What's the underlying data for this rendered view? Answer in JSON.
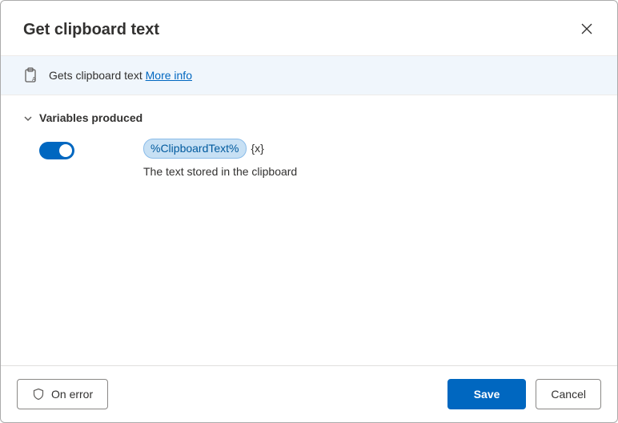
{
  "dialog": {
    "title": "Get clipboard text"
  },
  "banner": {
    "desc_prefix": "Gets clipboard text ",
    "more_info": "More info"
  },
  "section": {
    "heading": "Variables produced"
  },
  "variable": {
    "name": "%ClipboardText%",
    "type_suffix": "{x}",
    "description": "The text stored in the clipboard",
    "enabled": true
  },
  "footer": {
    "on_error": "On error",
    "save": "Save",
    "cancel": "Cancel"
  }
}
